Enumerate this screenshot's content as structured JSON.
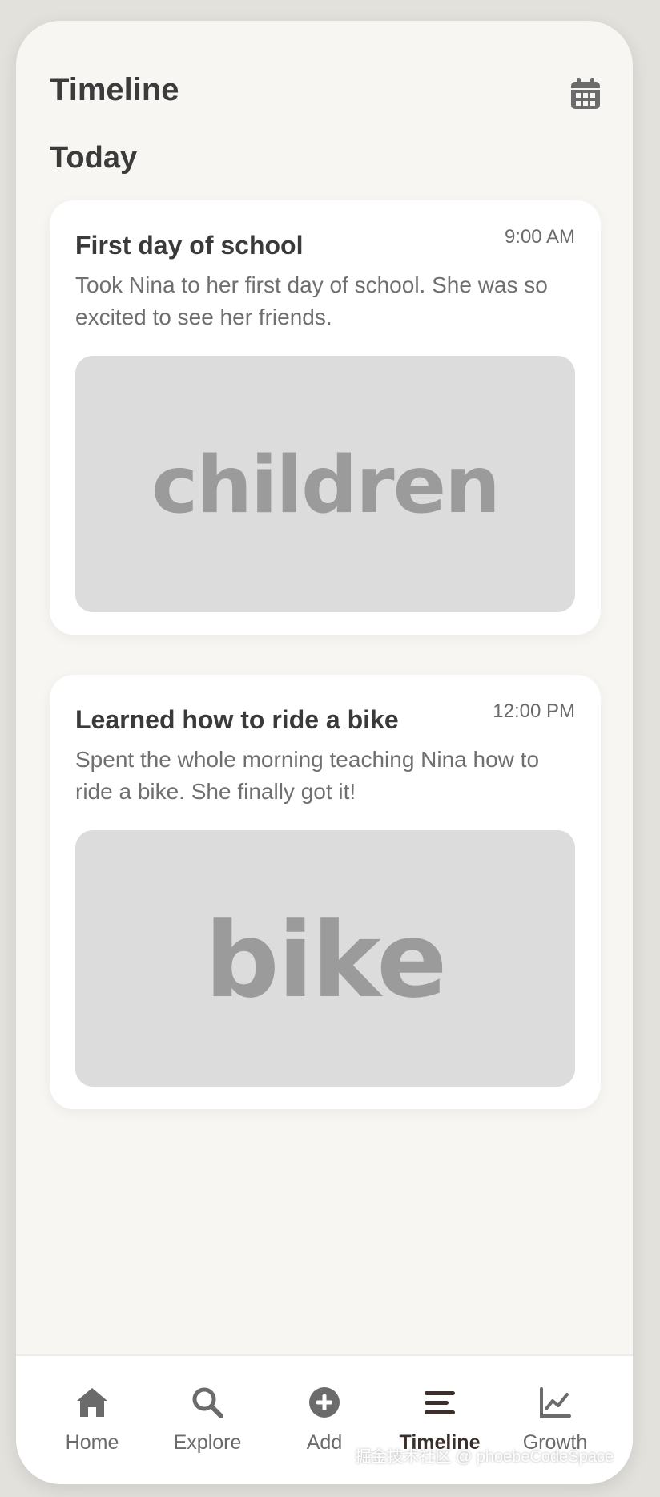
{
  "header": {
    "title": "Timeline"
  },
  "section": {
    "title": "Today"
  },
  "entries": [
    {
      "title": "First day of school",
      "time": "9:00 AM",
      "description": "Took Nina to her first day of school. She was so excited to see her friends.",
      "photo_label": "children"
    },
    {
      "title": "Learned how to ride a bike",
      "time": "12:00 PM",
      "description": "Spent the whole morning teaching Nina how to ride a bike. She finally got it!",
      "photo_label": "bike"
    }
  ],
  "nav": {
    "items": [
      {
        "label": "Home",
        "icon": "home-icon"
      },
      {
        "label": "Explore",
        "icon": "search-icon"
      },
      {
        "label": "Add",
        "icon": "add-circle-icon"
      },
      {
        "label": "Timeline",
        "icon": "list-icon",
        "active": true
      },
      {
        "label": "Growth",
        "icon": "chart-icon"
      }
    ]
  },
  "watermark": "掘金技术社区 @ phoebeCodeSpace",
  "colors": {
    "background": "#f8f6f2",
    "card": "#ffffff",
    "text_primary": "#3b3b3b",
    "text_secondary": "#6f6f6f",
    "photo_placeholder": "#dcdcdc",
    "nav_active": "#3a2f2a"
  }
}
